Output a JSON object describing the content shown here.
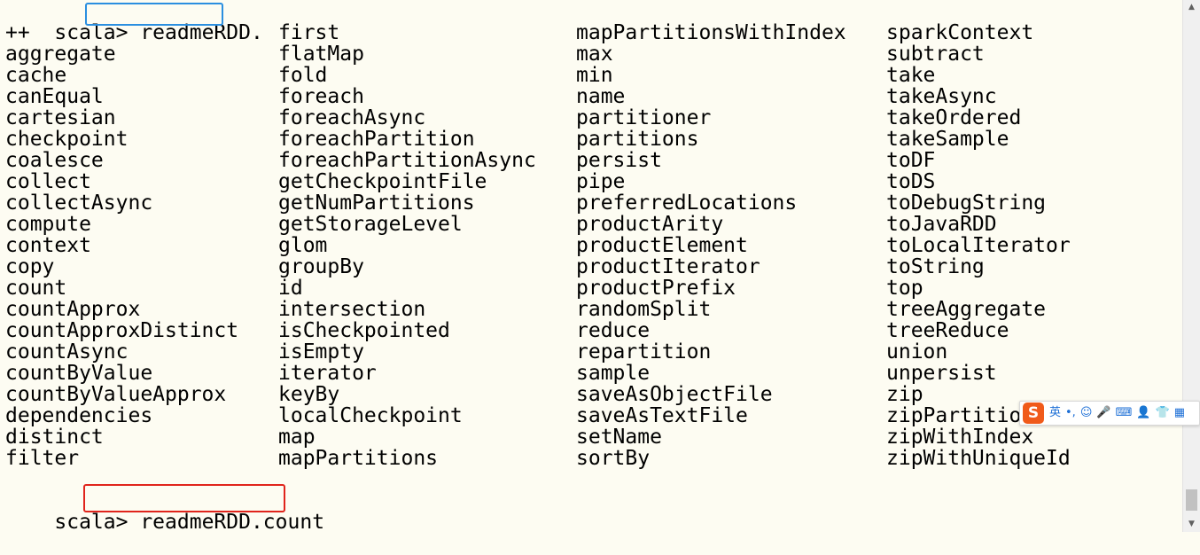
{
  "terminal": {
    "prompt1": "scala> ",
    "command1": "readmeRDD.",
    "columns": [
      [
        "++",
        "aggregate",
        "cache",
        "canEqual",
        "cartesian",
        "checkpoint",
        "coalesce",
        "collect",
        "collectAsync",
        "compute",
        "context",
        "copy",
        "count",
        "countApprox",
        "countApproxDistinct",
        "countAsync",
        "countByValue",
        "countByValueApprox",
        "dependencies",
        "distinct",
        "filter"
      ],
      [
        "first",
        "flatMap",
        "fold",
        "foreach",
        "foreachAsync",
        "foreachPartition",
        "foreachPartitionAsync",
        "getCheckpointFile",
        "getNumPartitions",
        "getStorageLevel",
        "glom",
        "groupBy",
        "id",
        "intersection",
        "isCheckpointed",
        "isEmpty",
        "iterator",
        "keyBy",
        "localCheckpoint",
        "map",
        "mapPartitions"
      ],
      [
        "mapPartitionsWithIndex",
        "max",
        "min",
        "name",
        "partitioner",
        "partitions",
        "persist",
        "pipe",
        "preferredLocations",
        "productArity",
        "productElement",
        "productIterator",
        "productPrefix",
        "randomSplit",
        "reduce",
        "repartition",
        "sample",
        "saveAsObjectFile",
        "saveAsTextFile",
        "setName",
        "sortBy"
      ],
      [
        "sparkContext",
        "subtract",
        "take",
        "takeAsync",
        "takeOrdered",
        "takeSample",
        "toDF",
        "toDS",
        "toDebugString",
        "toJavaRDD",
        "toLocalIterator",
        "toString",
        "top",
        "treeAggregate",
        "treeReduce",
        "union",
        "unpersist",
        "zip",
        "zipPartitio",
        "zipWithIndex",
        "zipWithUniqueId"
      ]
    ],
    "prompt2": "scala> ",
    "command2": "readmeRDD.count"
  },
  "highlight_colors": {
    "first_command": "#2b8fe0",
    "second_command": "#e0241c"
  },
  "scrollbar": {
    "up_arrow": "▲",
    "down_arrow": "▼"
  },
  "ime_toolbar": {
    "logo": "S",
    "items": [
      {
        "name": "lang-toggle-icon",
        "glyph": "英"
      },
      {
        "name": "punctuation-icon",
        "glyph": "•,"
      },
      {
        "name": "emoji-icon",
        "glyph": "☺"
      },
      {
        "name": "voice-icon",
        "glyph": "🎤"
      },
      {
        "name": "keyboard-icon",
        "glyph": "⌨"
      },
      {
        "name": "user-icon",
        "glyph": "👤"
      },
      {
        "name": "skin-icon",
        "glyph": "👕"
      },
      {
        "name": "grid-menu-icon",
        "glyph": "▦"
      }
    ]
  }
}
